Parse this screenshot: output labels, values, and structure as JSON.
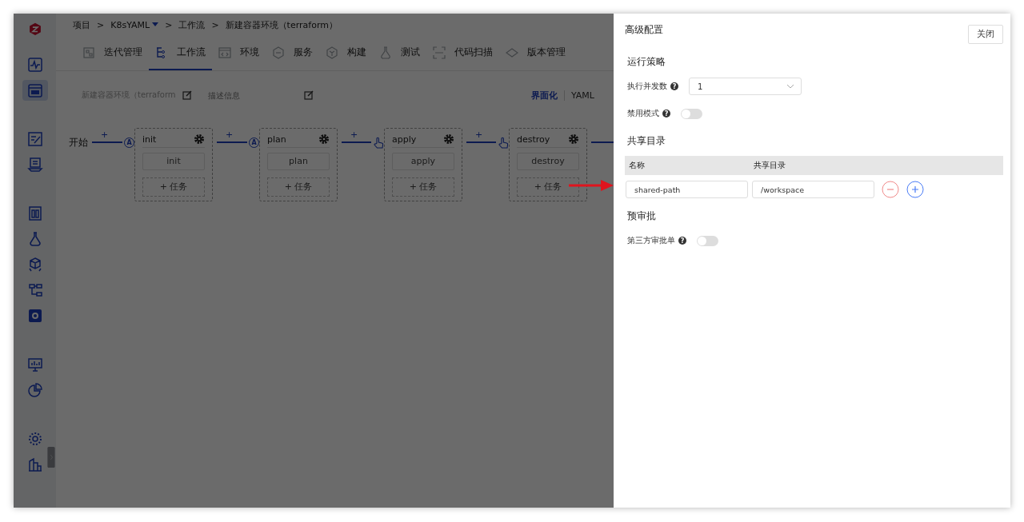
{
  "sidebar": {
    "groups": [
      [
        {
          "selected": false
        },
        {
          "selected": true
        }
      ],
      [
        {
          "selected": false
        },
        {
          "selected": false
        }
      ],
      [
        {
          "selected": false
        },
        {
          "selected": false
        },
        {
          "selected": false
        },
        {
          "selected": false
        },
        {
          "selected": false
        }
      ],
      [
        {
          "selected": false
        },
        {
          "selected": false
        }
      ],
      [
        {
          "selected": false
        },
        {
          "selected": false
        }
      ]
    ]
  },
  "breadcrumb": [
    {
      "label": "项目",
      "dropdown": false
    },
    {
      "label": "K8sYAML",
      "dropdown": true
    },
    {
      "label": "工作流",
      "dropdown": false
    },
    {
      "label": "新建容器环境（terraform）",
      "dropdown": false
    }
  ],
  "breadcrumb_separator": ">",
  "tabs": [
    {
      "label": "迭代管理",
      "selected": false
    },
    {
      "label": "工作流",
      "selected": true
    },
    {
      "label": "环境",
      "selected": false
    },
    {
      "label": "服务",
      "selected": false
    },
    {
      "label": "构建",
      "selected": false
    },
    {
      "label": "测试",
      "selected": false
    },
    {
      "label": "代码扫描",
      "selected": false
    },
    {
      "label": "版本管理",
      "selected": false
    }
  ],
  "toolbar": {
    "name": "新建容器环境（terraform",
    "description_placeholder": "描述信息",
    "views": [
      {
        "label": "界面化",
        "selected": true
      },
      {
        "label": "YAML",
        "selected": false
      }
    ]
  },
  "workflow": {
    "start": "开始",
    "stages": [
      {
        "connector": "+",
        "trigger": {
          "kind": "auto",
          "label": "A"
        },
        "name": "init",
        "job": "init",
        "add_task": "+ 任务"
      },
      {
        "connector": "+",
        "trigger": {
          "kind": "auto",
          "label": "A"
        },
        "name": "plan",
        "job": "plan",
        "add_task": "+ 任务"
      },
      {
        "connector": "+",
        "trigger": {
          "kind": "manual"
        },
        "name": "apply",
        "job": "apply",
        "add_task": "+ 任务"
      },
      {
        "connector": "+",
        "trigger": {
          "kind": "manual"
        },
        "name": "destroy",
        "job": "destroy",
        "add_task": "+ 任务"
      }
    ]
  },
  "drawer": {
    "title": "高级配置",
    "close": "关闭",
    "sections": [
      {
        "title": "运行策略",
        "fields": [
          {
            "kind": "select",
            "label": "执行并发数",
            "help": "?",
            "value": "1"
          },
          {
            "kind": "toggle",
            "label": "禁用模式",
            "help": "?",
            "on": false
          }
        ]
      },
      {
        "title": "共享目录",
        "table": {
          "columns": [
            "名称",
            "共享目录"
          ],
          "rows": [
            {
              "cells": [
                "shared-path",
                "/workspace"
              ]
            }
          ]
        }
      },
      {
        "title": "预审批",
        "fields": [
          {
            "kind": "toggle",
            "label": "第三方审批单",
            "help": "?",
            "on": false
          }
        ]
      }
    ]
  }
}
